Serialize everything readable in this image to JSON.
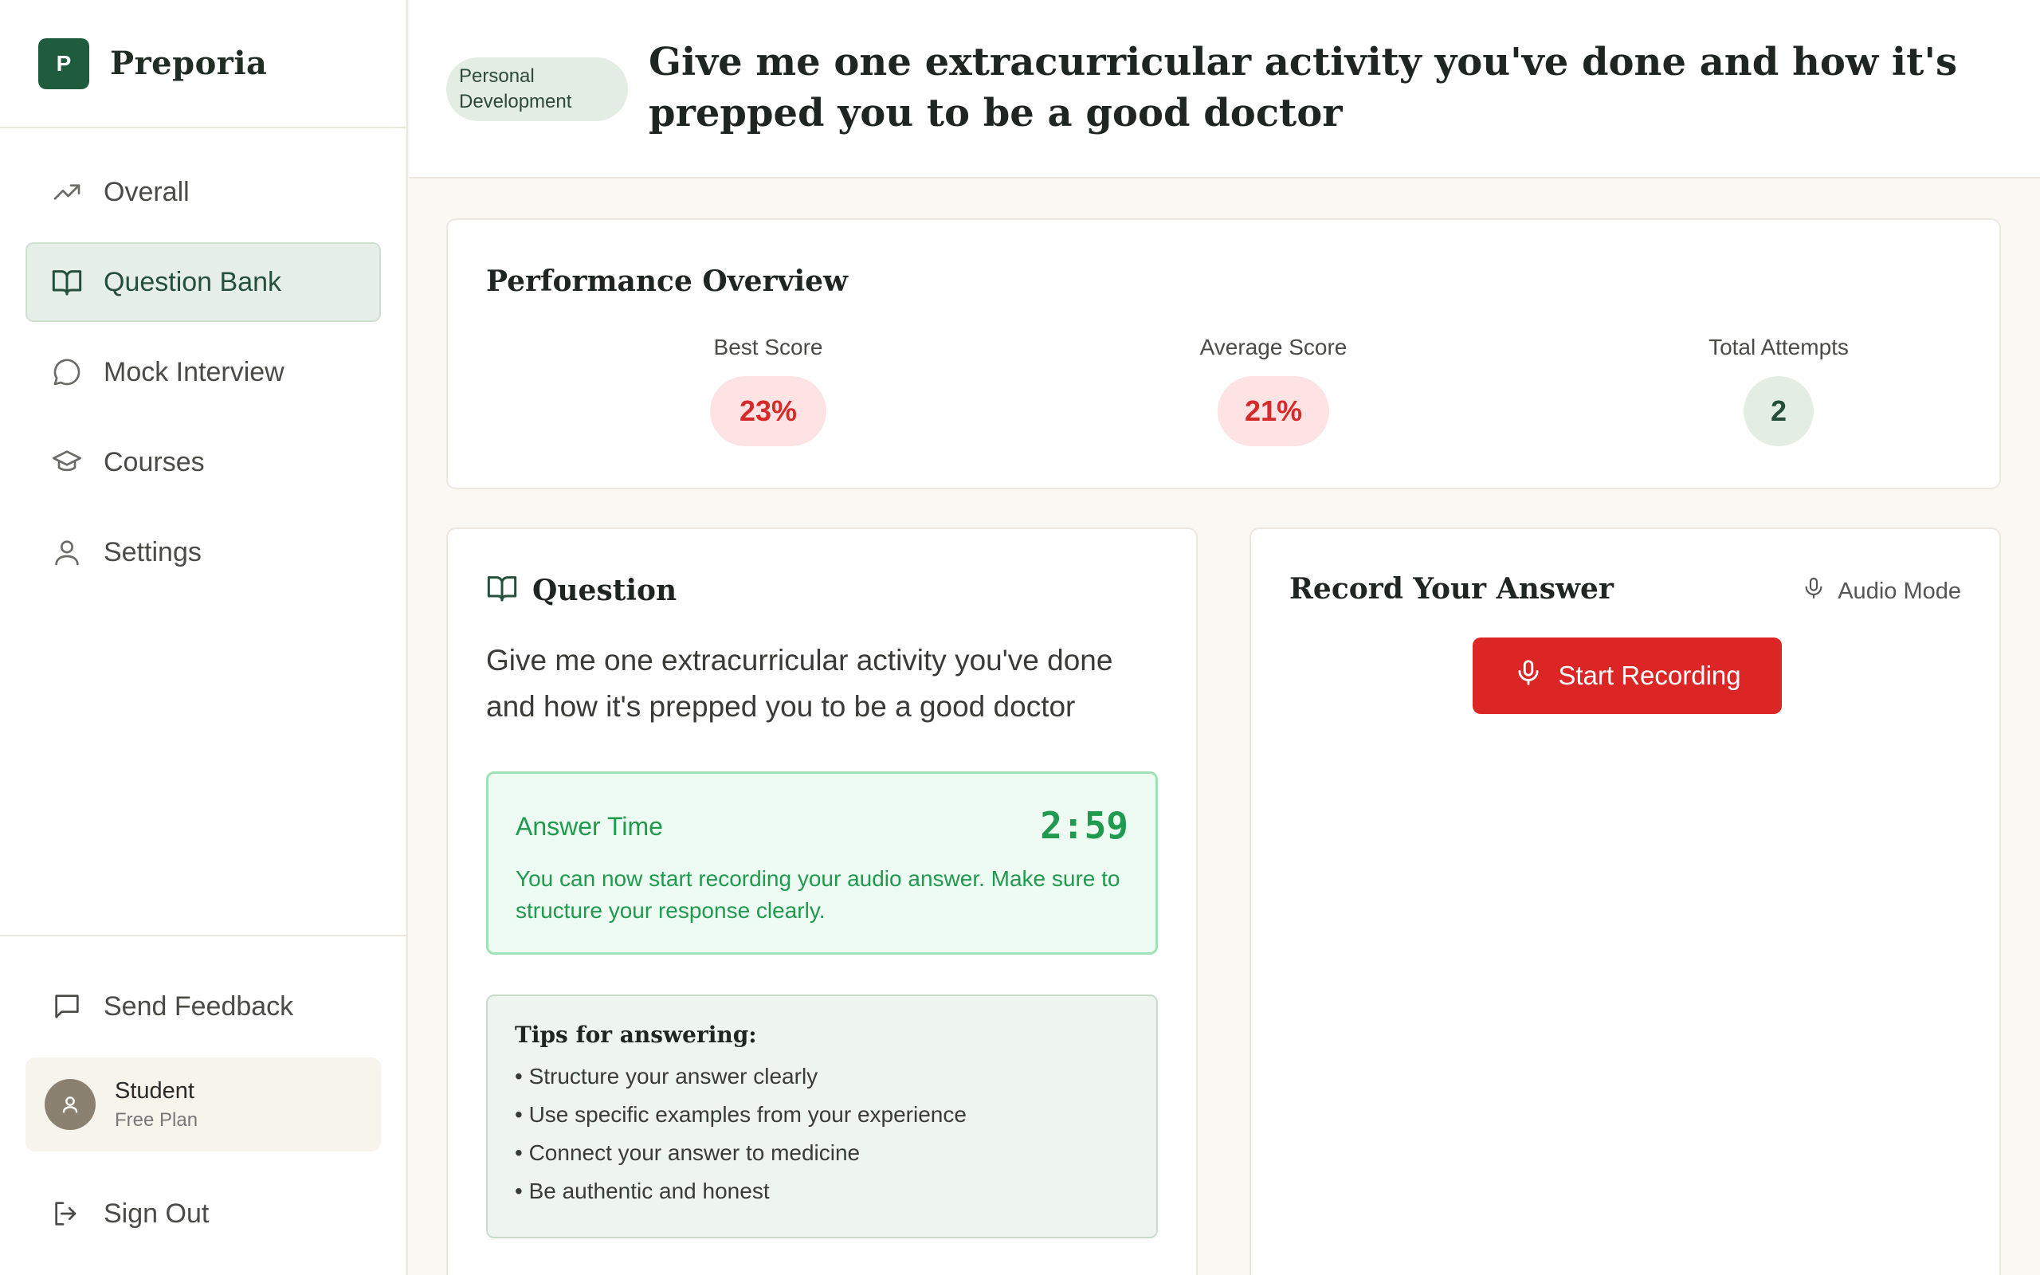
{
  "brand": {
    "logo_letter": "P",
    "name": "Preporia"
  },
  "nav": [
    {
      "label": "Overall",
      "icon": "trending-up-icon",
      "active": false
    },
    {
      "label": "Question Bank",
      "icon": "book-open-icon",
      "active": true
    },
    {
      "label": "Mock Interview",
      "icon": "message-circle-icon",
      "active": false
    },
    {
      "label": "Courses",
      "icon": "graduation-cap-icon",
      "active": false
    },
    {
      "label": "Settings",
      "icon": "user-icon",
      "active": false
    }
  ],
  "sidebar_bottom": {
    "feedback_label": "Send Feedback",
    "user": {
      "name": "Student",
      "plan": "Free Plan"
    },
    "signout_label": "Sign Out"
  },
  "header": {
    "category": "Personal Development",
    "title": "Give me one extracurricular activity you've done and how it's prepped you to be a good doctor"
  },
  "performance": {
    "title": "Performance Overview",
    "best_label": "Best Score",
    "best_value": "23%",
    "avg_label": "Average Score",
    "avg_value": "21%",
    "attempts_label": "Total Attempts",
    "attempts_value": "2"
  },
  "question": {
    "title": "Question",
    "text": "Give me one extracurricular activity you've done and how it's prepped you to be a good doctor",
    "timer_label": "Answer Time",
    "timer_value": "2:59",
    "timer_desc": "You can now start recording your audio answer. Make sure to structure your response clearly.",
    "tips_title": "Tips for answering:",
    "tips": [
      "• Structure your answer clearly",
      "• Use specific examples from your experience",
      "• Connect your answer to medicine",
      "• Be authentic and honest"
    ]
  },
  "record": {
    "title": "Record Your Answer",
    "mode_label": "Audio Mode",
    "button_label": "Start Recording"
  },
  "colors": {
    "brand": "#1f5c3d",
    "accent_red": "#dc2626",
    "success_green": "#1f9a4e"
  }
}
